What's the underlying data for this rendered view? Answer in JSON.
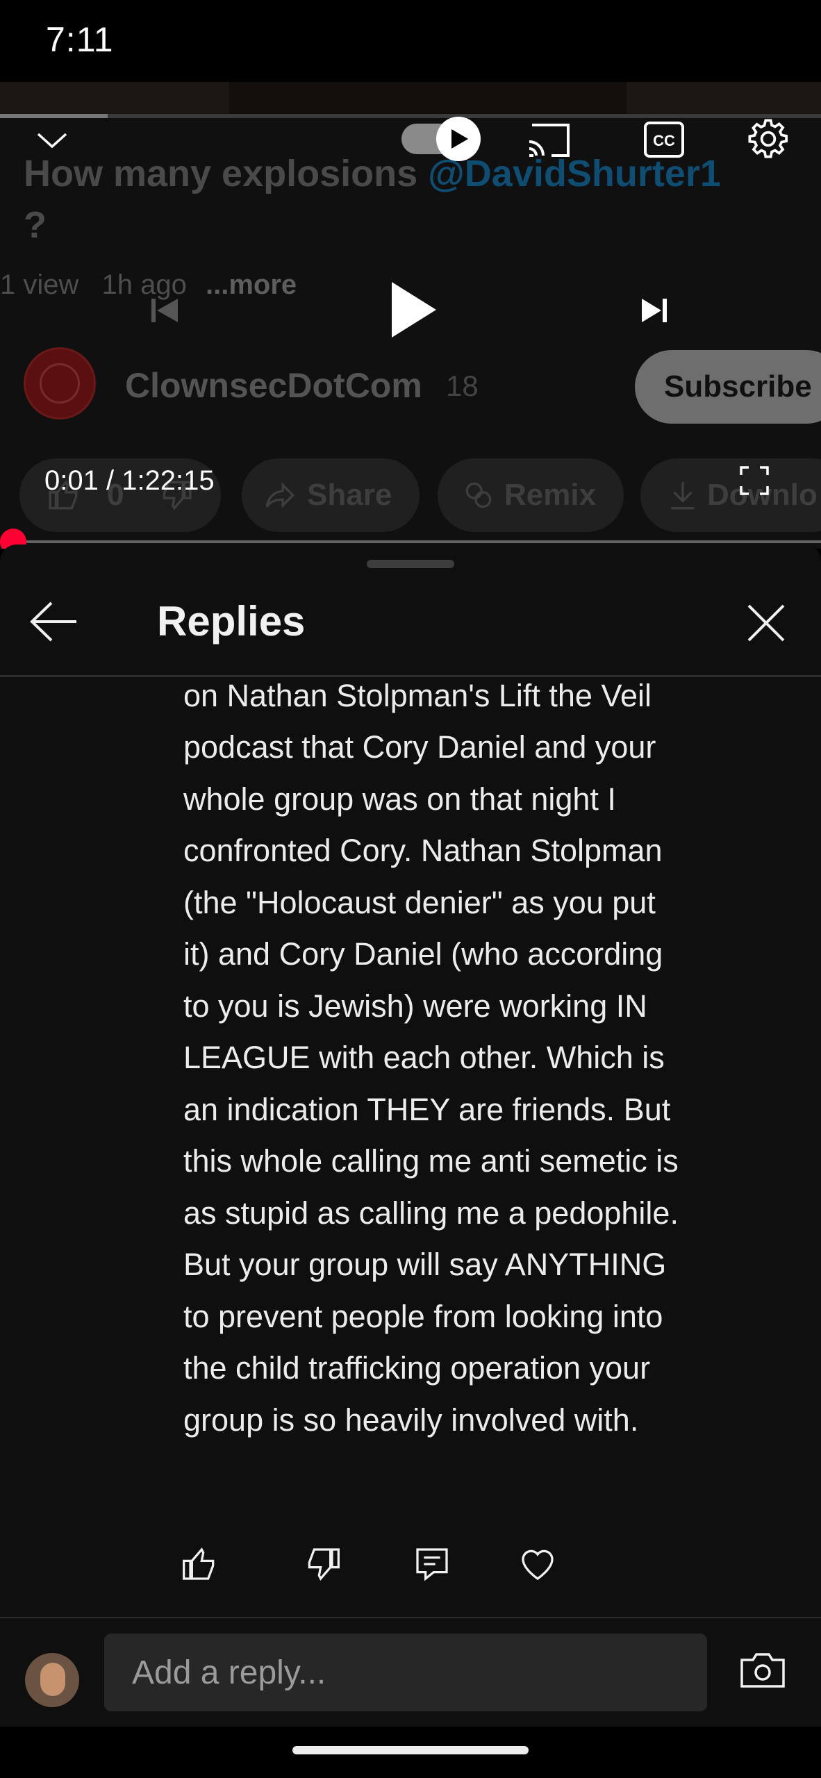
{
  "status_bar": {
    "time": "7:11"
  },
  "video": {
    "title": "How many explosions",
    "title_mention": "@DavidShurter1",
    "title_tail": "?",
    "views": "1 view",
    "age": "1h ago",
    "more_label": "...more",
    "channel_name": "ClownsecDotCom",
    "subscriber_count": "18",
    "subscribe_label": "Subscribe",
    "like_count": "0",
    "share_label": "Share",
    "remix_label": "Remix",
    "download_label": "Downlo",
    "time_readout": "0:01 / 1:22:15",
    "progress_fraction": 0.0002
  },
  "replies_panel": {
    "title": "Replies",
    "comment_text": "even know each other. But it WAS\non Nathan Stolpman's Lift the Veil\npodcast that Cory Daniel and your\nwhole group was on that night I\nconfronted Cory. Nathan Stolpman\n(the \"Holocaust denier\" as you put\nit) and Cory Daniel (who according\nto you is Jewish) were working IN\nLEAGUE with each other. Which is\nan indication THEY are friends. But\nthis whole calling me anti semetic is\nas stupid as calling me a pedophile.\nBut your group will say ANYTHING\nto prevent people from looking into\nthe child trafficking operation your\ngroup is so heavily involved with.",
    "reply_placeholder": "Add a reply..."
  },
  "colors": {
    "background": "#0f0f0f",
    "accent_red": "#ff0033",
    "mention_blue": "#0f4d73",
    "input_bg": "#272727"
  },
  "icons": [
    "chevron-down-icon",
    "autoplay-play-icon",
    "cast-icon",
    "captions-icon",
    "settings-gear-icon",
    "previous-icon",
    "play-icon",
    "next-icon",
    "fullscreen-icon",
    "back-arrow-icon",
    "close-icon",
    "thumbs-up-icon",
    "thumbs-down-icon",
    "reply-comment-icon",
    "heart-icon",
    "camera-icon"
  ]
}
